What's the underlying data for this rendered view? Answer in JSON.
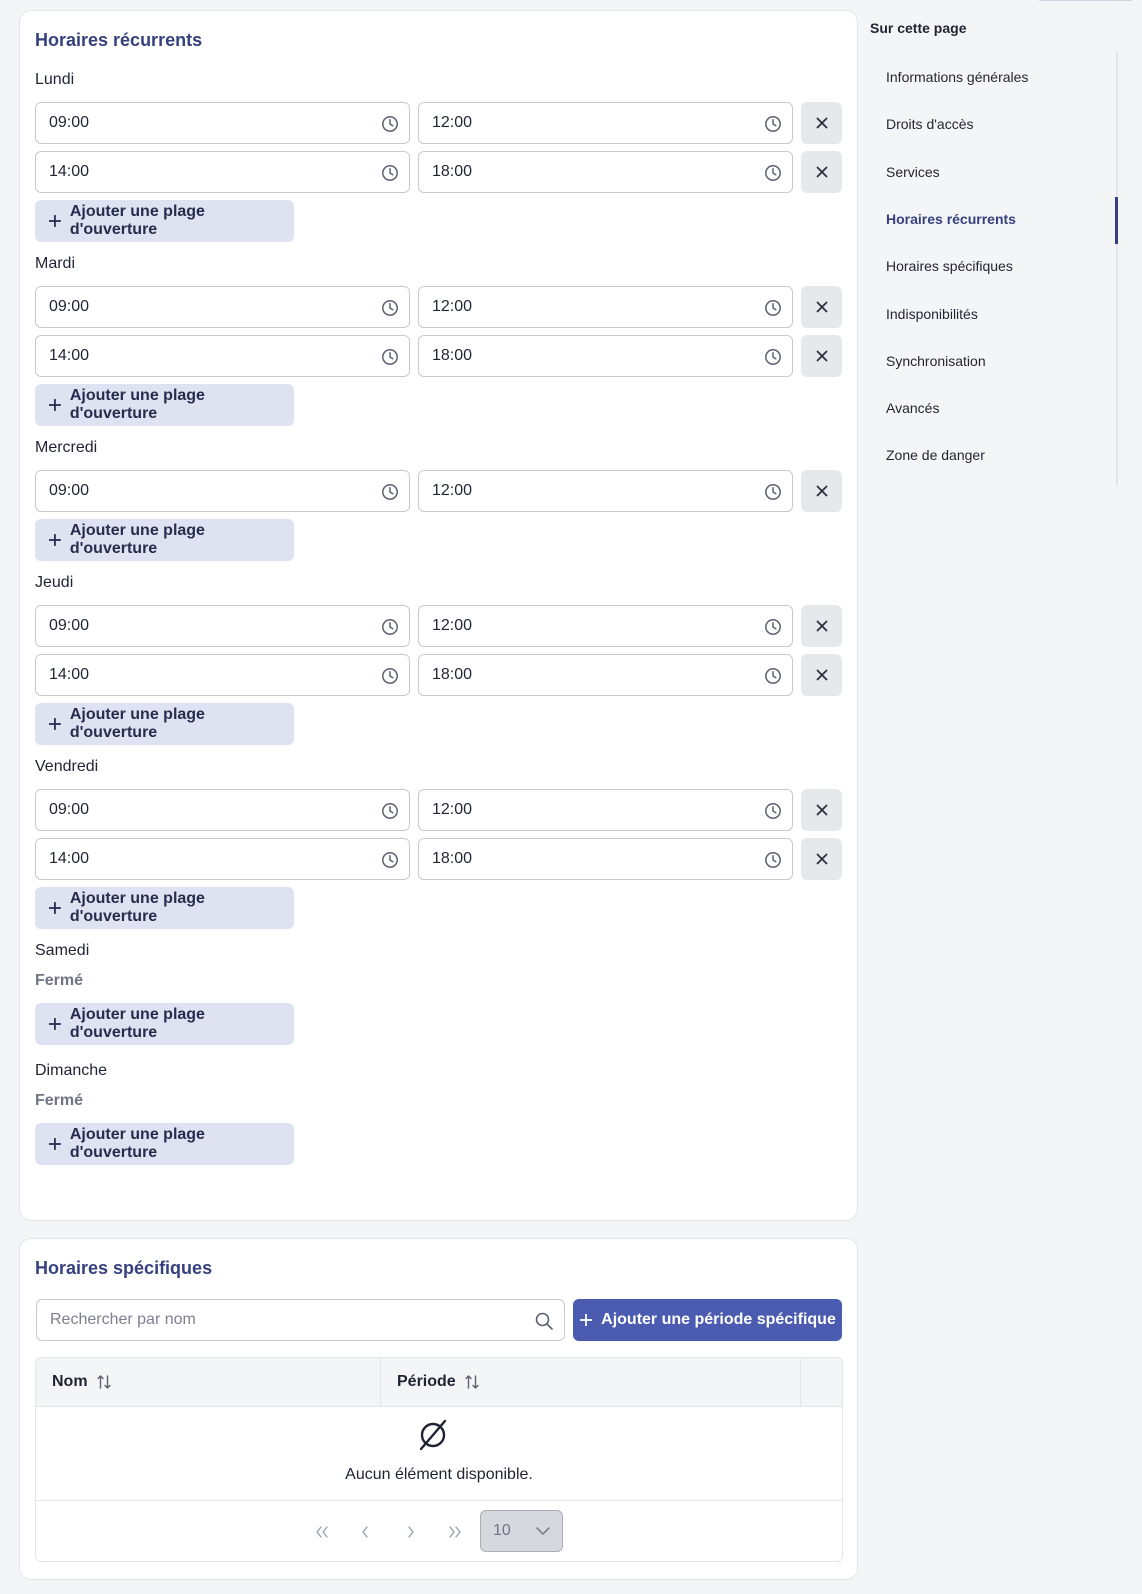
{
  "recurring": {
    "title": "Horaires récurrents",
    "add_range_label": "Ajouter une plage d'ouverture",
    "closed_label": "Fermé",
    "days": [
      {
        "name": "Lundi",
        "ranges": [
          {
            "start": "09:00",
            "end": "12:00"
          },
          {
            "start": "14:00",
            "end": "18:00"
          }
        ]
      },
      {
        "name": "Mardi",
        "ranges": [
          {
            "start": "09:00",
            "end": "12:00"
          },
          {
            "start": "14:00",
            "end": "18:00"
          }
        ]
      },
      {
        "name": "Mercredi",
        "ranges": [
          {
            "start": "09:00",
            "end": "12:00"
          }
        ]
      },
      {
        "name": "Jeudi",
        "ranges": [
          {
            "start": "09:00",
            "end": "12:00"
          },
          {
            "start": "14:00",
            "end": "18:00"
          }
        ]
      },
      {
        "name": "Vendredi",
        "ranges": [
          {
            "start": "09:00",
            "end": "12:00"
          },
          {
            "start": "14:00",
            "end": "18:00"
          }
        ]
      },
      {
        "name": "Samedi",
        "ranges": []
      },
      {
        "name": "Dimanche",
        "ranges": []
      }
    ]
  },
  "specific": {
    "title": "Horaires spécifiques",
    "search_placeholder": "Rechercher par nom",
    "add_period_label": "Ajouter une période spécifique",
    "columns": [
      "Nom",
      "Période"
    ],
    "empty_message": "Aucun élément disponible.",
    "rows_per_page": "10"
  },
  "toc": {
    "title": "Sur cette page",
    "items": [
      "Informations générales",
      "Droits d'accès",
      "Services",
      "Horaires récurrents",
      "Horaires spécifiques",
      "Indisponibilités",
      "Synchronisation",
      "Avancés",
      "Zone de danger"
    ],
    "active_index": 3
  },
  "icons": {
    "time_field": "clock-icon",
    "remove": "close-icon",
    "add": "plus-icon",
    "search": "search-icon",
    "sort": "sort-icon",
    "empty": "empty-set-icon"
  },
  "colors": {
    "accent": "#36407f",
    "primary_button": "#4a5bb0",
    "secondary_button": "#dfe3f1"
  }
}
